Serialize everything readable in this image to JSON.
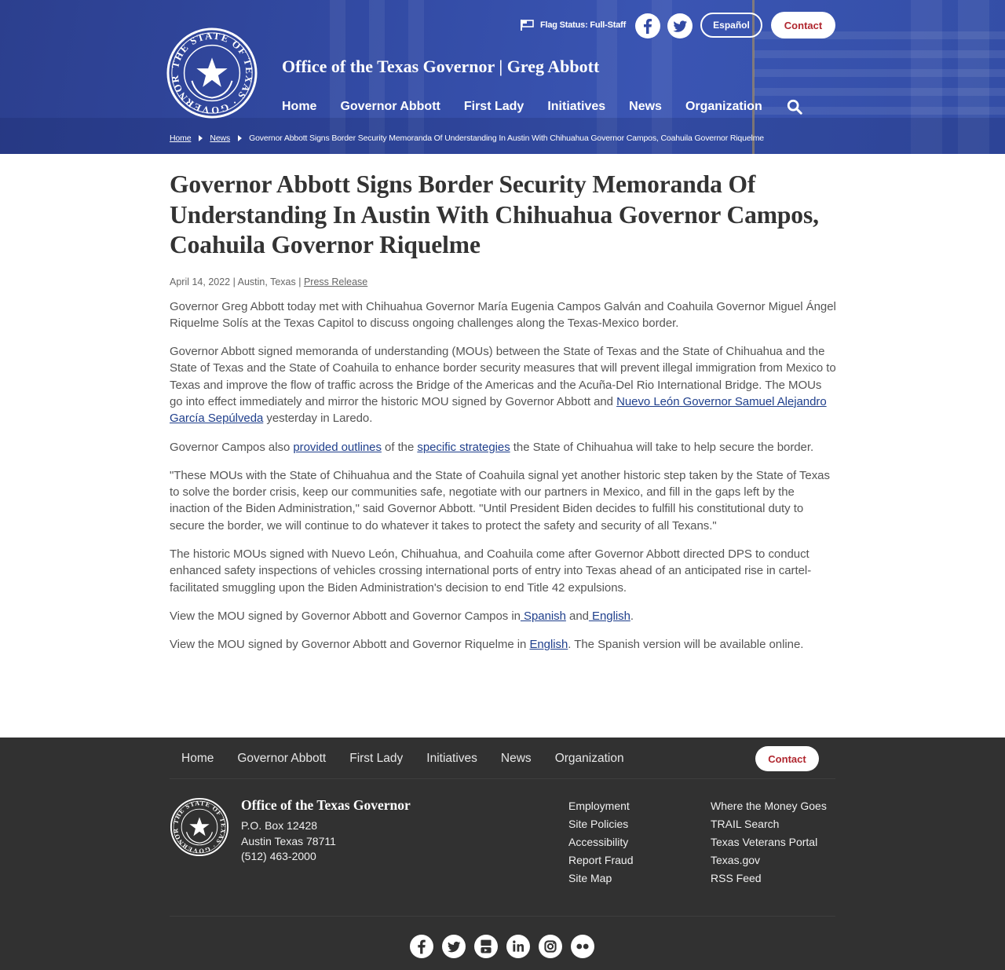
{
  "header": {
    "site_title": "Office of the Texas Governor | Greg Abbott",
    "flag_status": "Flag Status: Full-Staff",
    "espanol_label": "Español",
    "contact_label": "Contact",
    "nav": [
      "Home",
      "Governor Abbott",
      "First Lady",
      "Initiatives",
      "News",
      "Organization"
    ],
    "seal_text": "THE STATE OF TEXAS · GOVERNOR"
  },
  "breadcrumb": {
    "home": "Home",
    "news": "News",
    "current": "Governor Abbott Signs Border Security Memoranda Of Understanding In Austin With Chihuahua Governor Campos, Coahuila Governor Riquelme"
  },
  "article": {
    "title": "Governor Abbott Signs Border Security Memoranda Of Understanding In Austin With Chihuahua Governor Campos, Coahuila Governor Riquelme",
    "date_location": "April 14, 2022 | Austin, Texas | ",
    "category": "Press Release",
    "p1": "Governor Greg Abbott today met with Chihuahua Governor María Eugenia Campos Galván and Coahuila Governor Miguel Ángel Riquelme Solís at the Texas Capitol to discuss ongoing challenges along the Texas-Mexico border.",
    "p2_text": "Governor Abbott signed memoranda of understanding (MOUs) between the State of Texas and the State of Chihuahua and the State of Texas and the State of Coahuila to enhance border security measures that will prevent illegal immigration from Mexico to Texas and improve the flow of traffic across the Bridge of the Americas and the Acuña-Del Rio International Bridge. The MOUs go into effect immediately and mirror the historic MOU signed by Governor Abbott and ",
    "p2_link": "Nuevo León Governor Samuel Alejandro García Sepúlveda",
    "p2_tail": " yesterday in Laredo.",
    "p3_a": "Governor Campos also ",
    "p3_link1": "provided outlines",
    "p3_b": " of the ",
    "p3_link2": "specific strategies",
    "p3_c": " the State of Chihuahua will take to help secure the border.",
    "p4": "\"These MOUs with the State of Chihuahua and the State of Coahuila signal yet another historic step taken by the State of Texas to solve the border crisis, keep our communities safe, negotiate with our partners in Mexico, and fill in the gaps left by the inaction of the Biden Administration,\" said Governor Abbott. \"Until President Biden decides to fulfill his constitutional duty to secure the border, we will continue to do whatever it takes to protect the safety and security of all Texans.\"",
    "p5": "The historic MOUs signed with Nuevo León, Chihuahua, and Coahuila come after Governor Abbott directed DPS to conduct enhanced safety inspections of vehicles crossing international ports of entry into Texas ahead of an anticipated rise in cartel-facilitated smuggling upon the Biden Administration's decision to end Title 42 expulsions.",
    "p6_a": "View the MOU signed by Governor Abbott and Governor Campos in",
    "p6_link1": " Spanish",
    "p6_b": " and",
    "p6_link2": " English",
    "p6_c": ".",
    "p7_a": "View the MOU signed by Governor Abbott and Governor Riquelme in ",
    "p7_link": "English",
    "p7_b": ". The Spanish version will be available online."
  },
  "footer": {
    "nav": [
      "Home",
      "Governor Abbott",
      "First Lady",
      "Initiatives",
      "News",
      "Organization"
    ],
    "contact_label": "Contact",
    "office_name": "Office of the Texas Governor",
    "address1": "P.O. Box 12428",
    "address2": "Austin Texas 78711",
    "phone": "(512) 463-2000",
    "links_col1": [
      "Employment",
      "Site Policies",
      "Accessibility",
      "Report Fraud",
      "Site Map"
    ],
    "links_col2": [
      "Where the Money Goes",
      "TRAIL Search",
      "Texas Veterans Portal",
      "Texas.gov",
      "RSS Feed"
    ],
    "social_icons": [
      "facebook-icon",
      "twitter-icon",
      "youtube-icon",
      "linkedin-icon",
      "instagram-icon",
      "flickr-icon"
    ]
  },
  "colors": {
    "header_blue": "#324aa3",
    "contact_red": "#b0262e",
    "link_blue": "#1f3f8c",
    "footer_bg": "#313131"
  }
}
